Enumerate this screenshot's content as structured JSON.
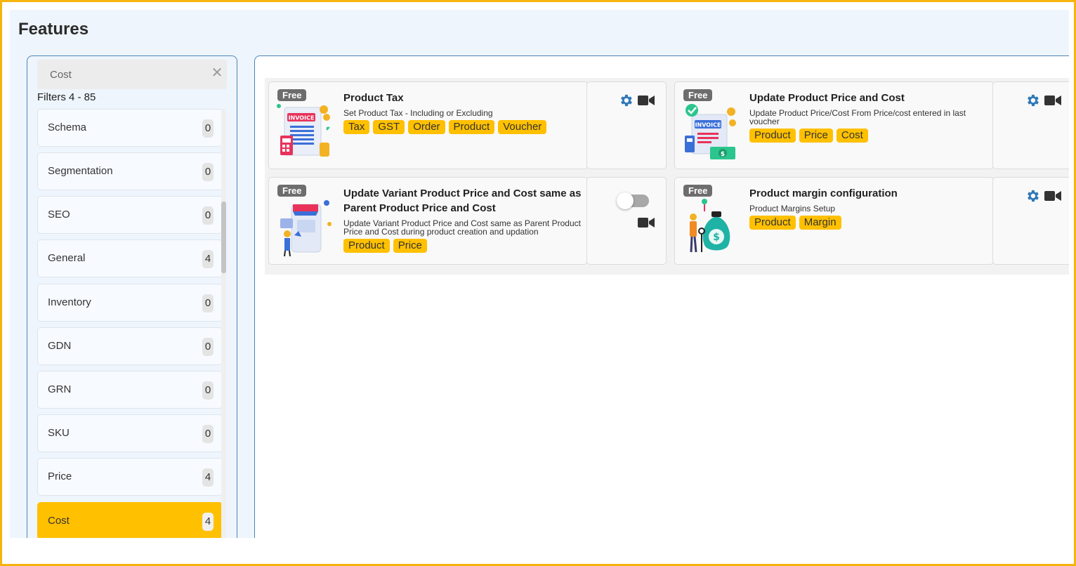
{
  "page": {
    "title": "Features"
  },
  "search": {
    "value": "Cost",
    "clear_icon": "close-icon"
  },
  "filters": {
    "count_label": "Filters 4 - 85",
    "items": [
      {
        "label": "Schema",
        "count": "0"
      },
      {
        "label": "Segmentation",
        "count": "0"
      },
      {
        "label": "SEO",
        "count": "0"
      },
      {
        "label": "General",
        "count": "4"
      },
      {
        "label": "Inventory",
        "count": "0"
      },
      {
        "label": "GDN",
        "count": "0"
      },
      {
        "label": "GRN",
        "count": "0"
      },
      {
        "label": "SKU",
        "count": "0"
      },
      {
        "label": "Price",
        "count": "4"
      },
      {
        "label": "Cost",
        "count": "4",
        "active": true
      }
    ]
  },
  "cards": [
    {
      "badge": "Free",
      "title": "Product Tax",
      "description": "Set Product Tax - Including or Excluding",
      "tags": [
        "Tax",
        "GST",
        "Order",
        "Product",
        "Voucher"
      ],
      "actions": [
        "gear-icon",
        "video-icon"
      ]
    },
    {
      "badge": "Free",
      "title": "Update Product Price and Cost",
      "description_lines": [
        "Update Product Price/Cost From Price/cost entered in last",
        "voucher"
      ],
      "tags": [
        "Product",
        "Price",
        "Cost"
      ],
      "actions": [
        "gear-icon",
        "video-icon"
      ]
    },
    {
      "badge": "Free",
      "title_lines": [
        "Update Variant Product Price and Cost same as",
        "Parent Product Price and Cost"
      ],
      "description_lines": [
        "Update Variant Product Price and Cost same as Parent Product",
        "Price and Cost during product creation and updation"
      ],
      "tags": [
        "Product",
        "Price"
      ],
      "enabled": false,
      "actions": [
        "toggle-switch",
        "video-icon"
      ]
    },
    {
      "badge": "Free",
      "title": "Product margin configuration",
      "description": "Product Margins Setup",
      "tags": [
        "Product",
        "Margin"
      ],
      "actions": [
        "gear-icon",
        "video-icon"
      ]
    }
  ],
  "colors": {
    "accent": "#ffc000",
    "icon_blue": "#2f78b7",
    "frame": "#f6b40e",
    "border_blue": "#4a84b8",
    "page_bg": "#eef5fc"
  }
}
